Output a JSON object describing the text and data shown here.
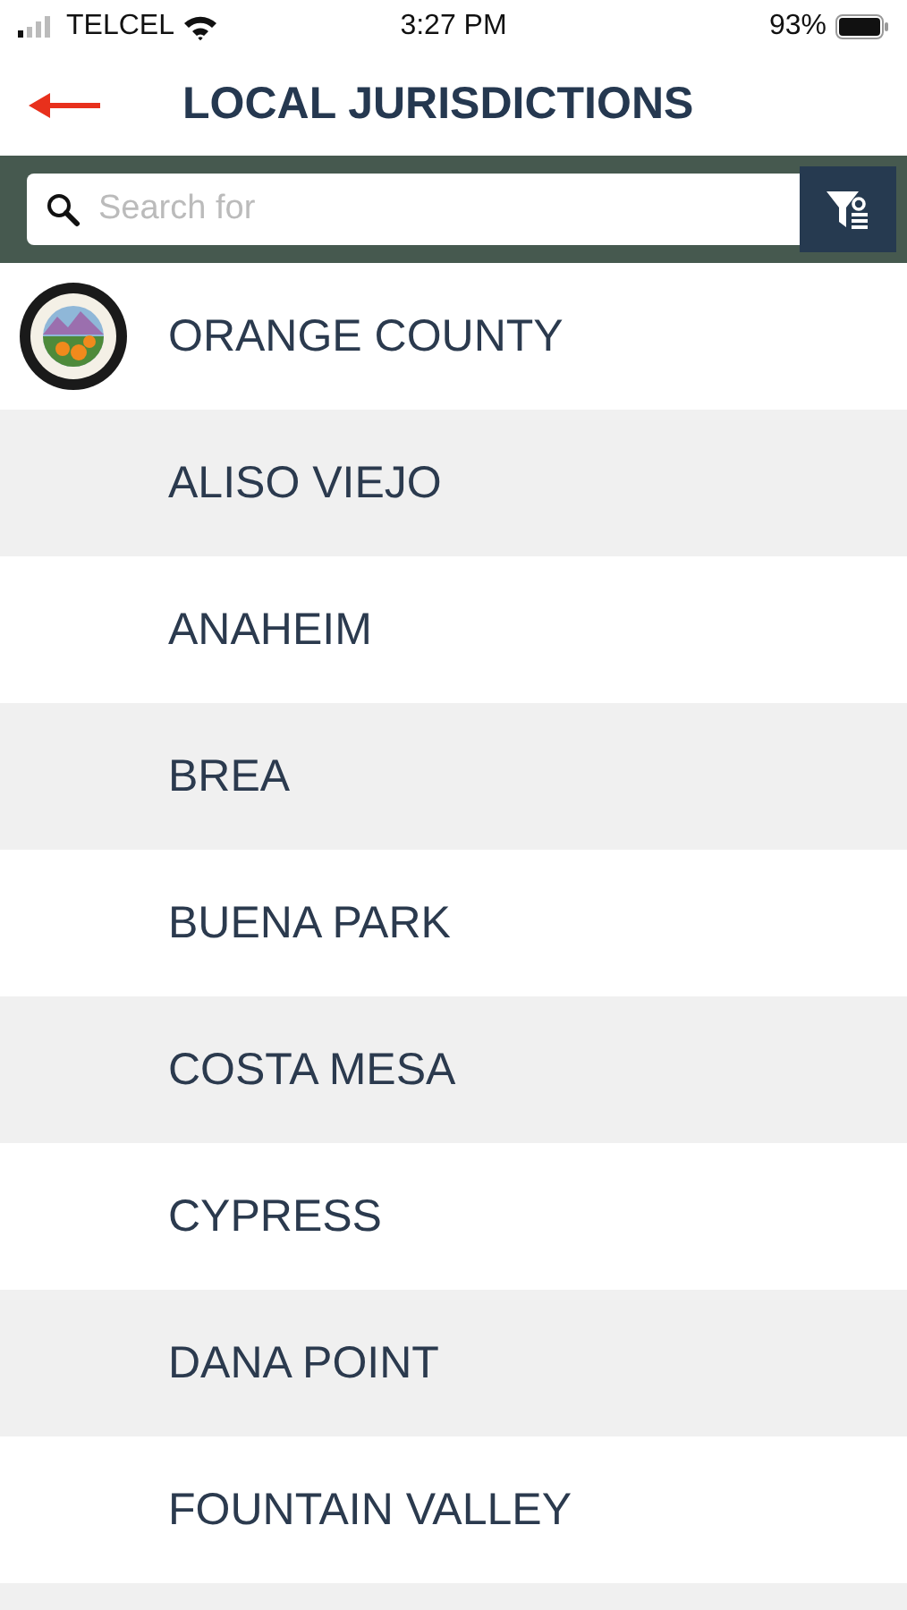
{
  "status_bar": {
    "carrier": "TELCEL",
    "time": "3:27 PM",
    "battery": "93%"
  },
  "header": {
    "title": "LOCAL JURISDICTIONS"
  },
  "search": {
    "placeholder": "Search for"
  },
  "jurisdictions": [
    {
      "name": "ORANGE COUNTY",
      "kind": "seal"
    },
    {
      "name": "ALISO VIEJO",
      "kind": "plain"
    },
    {
      "name": "ANAHEIM",
      "kind": "plain"
    },
    {
      "name": "BREA",
      "kind": "plain"
    },
    {
      "name": "BUENA PARK",
      "kind": "plain"
    },
    {
      "name": "COSTA MESA",
      "kind": "plain"
    },
    {
      "name": "CYPRESS",
      "kind": "plain"
    },
    {
      "name": "DANA POINT",
      "kind": "plain"
    },
    {
      "name": "FOUNTAIN VALLEY",
      "kind": "plain"
    }
  ]
}
